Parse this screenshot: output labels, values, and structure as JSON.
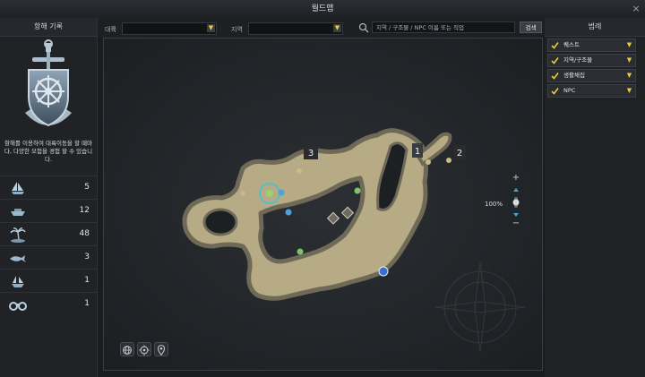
{
  "window": {
    "title": "월드맵",
    "close_label": "×"
  },
  "filters": {
    "continent_label": "대륙",
    "continent_value": "",
    "region_label": "지역",
    "region_value": "",
    "search_placeholder": "지역 / 구조물 / NPC 이름 또는 직업",
    "search_button": "검색"
  },
  "voyage": {
    "title": "항해 기록",
    "description": "항해를 이용하여 대륙이동을 할 때마다, 다양한 모험을 경험 할 수 있습니다.",
    "stats": [
      {
        "icon": "sailing-ship-icon",
        "value": "5"
      },
      {
        "icon": "boat-icon",
        "value": "12"
      },
      {
        "icon": "palm-island-icon",
        "value": "48"
      },
      {
        "icon": "whale-icon",
        "value": "3"
      },
      {
        "icon": "ship-wreck-icon",
        "value": "1"
      },
      {
        "icon": "binoculars-icon",
        "value": "1"
      }
    ]
  },
  "legend": {
    "title": "범례",
    "items": [
      {
        "label": "퀘스트",
        "checked": true
      },
      {
        "label": "지역/구조물",
        "checked": true
      },
      {
        "label": "생활채집",
        "checked": true
      },
      {
        "label": "NPC",
        "checked": true
      }
    ]
  },
  "map": {
    "markers": [
      "1",
      "2",
      "3"
    ],
    "zoom_label": "100%",
    "zoom_in": "+",
    "zoom_out": "−"
  },
  "colors": {
    "accent": "#e8c94a",
    "island": "#b7ab86",
    "island_edge": "#6f6a58",
    "background": "#1a1c20",
    "player": "#3cc6d4"
  }
}
